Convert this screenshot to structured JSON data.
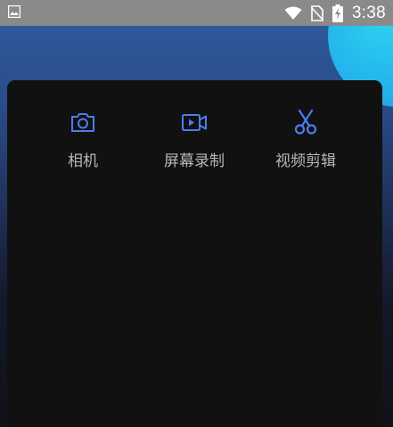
{
  "status_bar": {
    "time": "3:38",
    "icons": [
      "gallery-icon",
      "wifi-icon",
      "no-sim-icon",
      "battery-charging-icon"
    ]
  },
  "tools": [
    {
      "label": "相机",
      "icon": "camera-icon"
    },
    {
      "label": "屏幕录制",
      "icon": "screen-record-icon"
    },
    {
      "label": "视频剪辑",
      "icon": "scissors-icon"
    }
  ],
  "colors": {
    "icon_accent": "#4d7cf0",
    "sheet_bg": "#111111",
    "label_text": "#b7b7b7",
    "status_bar_bg": "#8a8a8a"
  }
}
